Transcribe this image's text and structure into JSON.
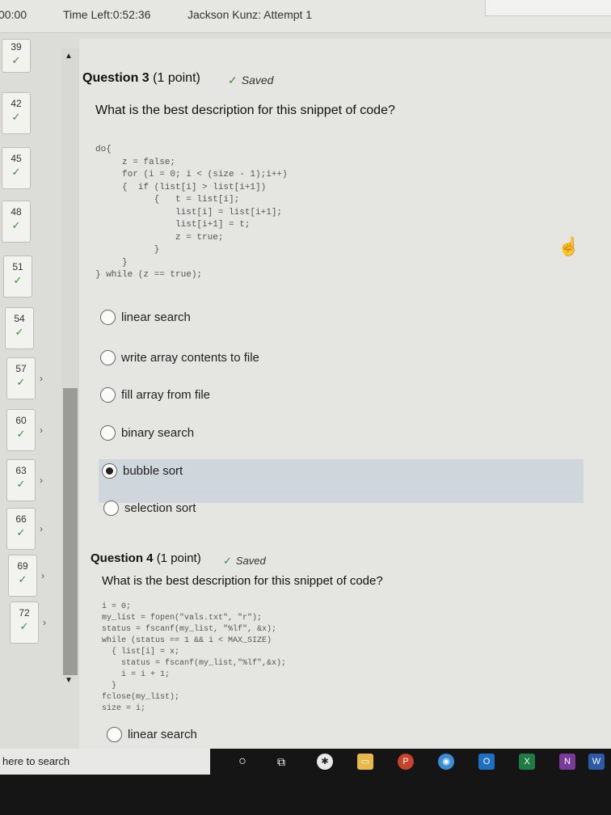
{
  "header": {
    "clock": "00:00",
    "time_left": "Time Left:0:52:36",
    "attempt": "Jackson Kunz: Attempt 1"
  },
  "sidebar": {
    "items": [
      {
        "num": "39",
        "check": "✓"
      },
      {
        "num": "42",
        "check": "✓"
      },
      {
        "num": "45",
        "check": "✓"
      },
      {
        "num": "48",
        "check": "✓"
      },
      {
        "num": "51",
        "check": "✓"
      },
      {
        "num": "54",
        "check": "✓"
      },
      {
        "num": "57",
        "check": "✓"
      },
      {
        "num": "60",
        "check": "✓"
      },
      {
        "num": "63",
        "check": "✓"
      },
      {
        "num": "66",
        "check": "✓"
      },
      {
        "num": "69",
        "check": "✓"
      },
      {
        "num": "72",
        "check": "✓"
      }
    ]
  },
  "question3": {
    "title": "Question 3",
    "points": "(1 point)",
    "saved": "Saved",
    "prompt": "What is the best description for this snippet of code?",
    "code": "do{\n     z = false;\n     for (i = 0; i < (size - 1);i++)\n     {  if (list[i] > list[i+1])\n           {   t = list[i];\n               list[i] = list[i+1];\n               list[i+1] = t;\n               z = true;\n           }\n     }\n} while (z == true);",
    "options": [
      {
        "label": "linear search",
        "selected": false
      },
      {
        "label": "write array contents to file",
        "selected": false
      },
      {
        "label": "fill array from file",
        "selected": false
      },
      {
        "label": "binary search",
        "selected": false
      },
      {
        "label": "bubble sort",
        "selected": true
      },
      {
        "label": "selection sort",
        "selected": false
      }
    ]
  },
  "question4": {
    "title": "Question 4",
    "points": "(1 point)",
    "saved": "Saved",
    "prompt": "What is the best description for this snippet of code?",
    "code": "i = 0;\nmy_list = fopen(\"vals.txt\", \"r\");\nstatus = fscanf(my_list, \"%lf\", &x);\nwhile (status == 1 && i < MAX_SIZE)\n  { list[i] = x;\n    status = fscanf(my_list,\"%lf\",&x);\n    i = i + 1;\n  }\nfclose(my_list);\nsize = i;",
    "options": [
      {
        "label": "linear search",
        "selected": false
      }
    ]
  },
  "taskbar": {
    "search_placeholder": "here to search",
    "icons": [
      "cortana-icon",
      "task-view-icon",
      "slack-icon",
      "file-explorer-icon",
      "powerpoint-icon",
      "chrome-icon",
      "outlook-icon",
      "excel-icon",
      "onenote-icon",
      "word-icon"
    ]
  }
}
